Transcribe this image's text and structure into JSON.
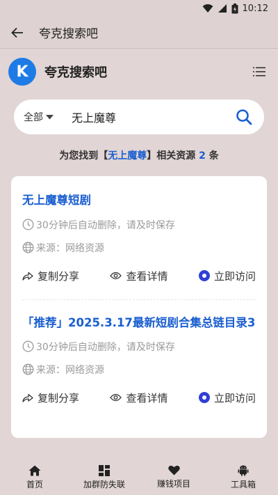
{
  "status_bar": {
    "time": "10:12"
  },
  "app_bar": {
    "title": "夸克搜索吧"
  },
  "site": {
    "logo_letter": "K",
    "name": "夸克搜索吧"
  },
  "search": {
    "scope": "全部",
    "query": "无上魔尊"
  },
  "summary": {
    "prefix": "为您找到【",
    "keyword": "无上魔尊",
    "middle": "】相关资源 ",
    "count": "2",
    "suffix": " 条"
  },
  "results": [
    {
      "title": "无上魔尊短剧",
      "expire": "30分钟后自动删除，请及时保存",
      "source": "来源：网络资源",
      "copy_label": "复制分享",
      "detail_label": "查看详情",
      "visit_label": "立即访问"
    },
    {
      "title": "「推荐」2025.3.17最新短剧合集总链目录3",
      "expire": "30分钟后自动删除，请及时保存",
      "source": "来源：网络资源",
      "copy_label": "复制分享",
      "detail_label": "查看详情",
      "visit_label": "立即访问"
    }
  ],
  "bottom_nav": [
    {
      "label": "首页",
      "icon": "home-icon"
    },
    {
      "label": "加群防失联",
      "icon": "grid-icon"
    },
    {
      "label": "赚钱项目",
      "icon": "heart-icon"
    },
    {
      "label": "工具箱",
      "icon": "android-icon"
    }
  ],
  "colors": {
    "accent": "#1b5fd0",
    "logo": "#1e7be6",
    "visit": "#2f3fd6",
    "background": "#e1d5d5"
  }
}
